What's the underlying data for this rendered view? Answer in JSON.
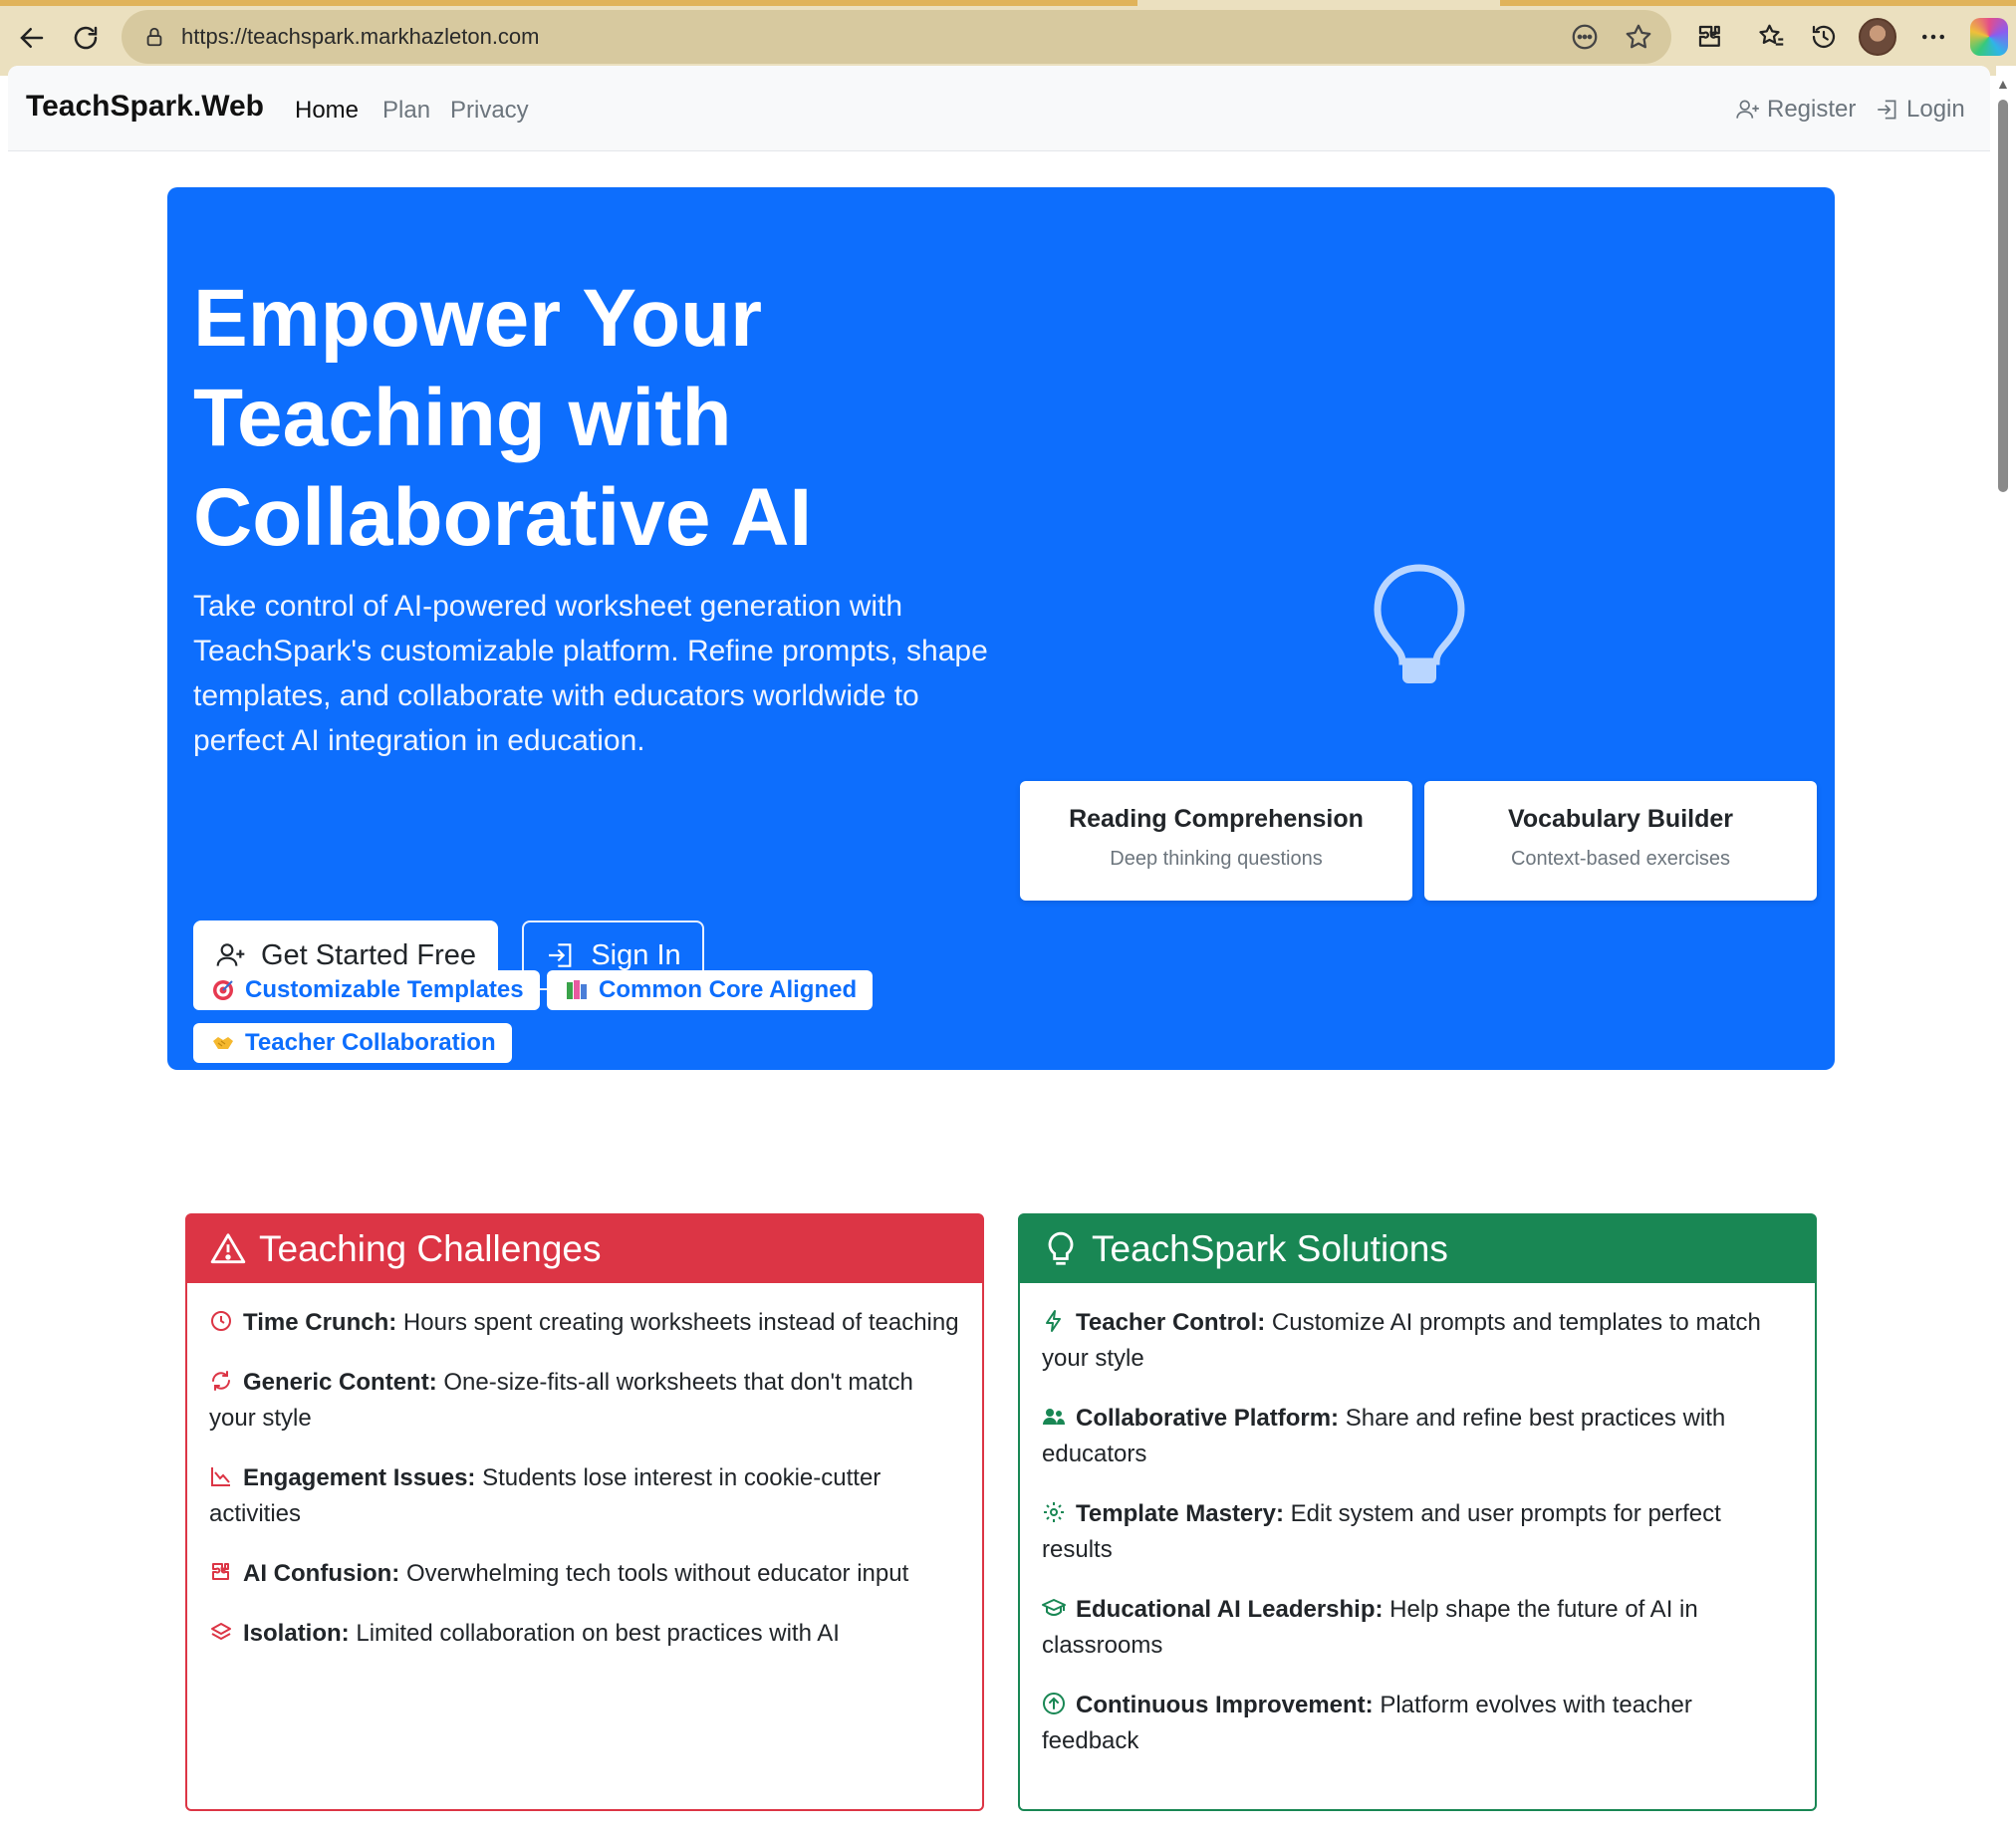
{
  "browser": {
    "url": "https://teachspark.markhazleton.com"
  },
  "navbar": {
    "brand": "TeachSpark.Web",
    "links": [
      {
        "label": "Home",
        "active": true
      },
      {
        "label": "Plan",
        "active": false
      },
      {
        "label": "Privacy",
        "active": false
      }
    ],
    "register_label": "Register",
    "login_label": "Login"
  },
  "hero": {
    "title": "Empower Your Teaching with Collaborative AI",
    "lead": "Take control of AI-powered worksheet generation with TeachSpark's customizable platform. Refine prompts, shape templates, and collaborate with educators worldwide to perfect AI integration in education.",
    "primary_button": "Get Started Free",
    "secondary_button": "Sign In",
    "badges": [
      {
        "icon": "target-emoji-icon",
        "label": "Customizable Templates"
      },
      {
        "icon": "books-emoji-icon",
        "label": "Common Core Aligned"
      },
      {
        "icon": "handshake-emoji-icon",
        "label": "Teacher Collaboration"
      }
    ],
    "feature_cards": [
      {
        "title": "Reading Comprehension",
        "subtitle": "Deep thinking questions"
      },
      {
        "title": "Vocabulary Builder",
        "subtitle": "Context-based exercises"
      }
    ],
    "colors": {
      "primary": "#0d6efd"
    }
  },
  "challenges": {
    "title": "Teaching Challenges",
    "color": "#dc3545",
    "items": [
      {
        "icon": "clock-icon",
        "label": "Time Crunch:",
        "text": " Hours spent creating worksheets instead of teaching"
      },
      {
        "icon": "arrows-repeat-icon",
        "label": "Generic Content:",
        "text": " One-size-fits-all worksheets that don't match your style"
      },
      {
        "icon": "graph-down-icon",
        "label": "Engagement Issues:",
        "text": " Students lose interest in cookie-cutter activities"
      },
      {
        "icon": "puzzle-icon",
        "label": "AI Confusion:",
        "text": " Overwhelming tech tools without educator input"
      },
      {
        "icon": "layers-icon",
        "label": "Isolation:",
        "text": " Limited collaboration on best practices with AI"
      }
    ]
  },
  "solutions": {
    "title": "TeachSpark Solutions",
    "color": "#198754",
    "items": [
      {
        "icon": "lightning-icon",
        "label": "Teacher Control:",
        "text": " Customize AI prompts and templates to match your style"
      },
      {
        "icon": "people-icon",
        "label": "Collaborative Platform:",
        "text": " Share and refine best practices with educators"
      },
      {
        "icon": "gear-icon",
        "label": "Template Mastery:",
        "text": " Edit system and user prompts for perfect results"
      },
      {
        "icon": "mortarboard-icon",
        "label": "Educational AI Leadership:",
        "text": " Help shape the future of AI in classrooms"
      },
      {
        "icon": "arrow-up-circle-icon",
        "label": "Continuous Improvement:",
        "text": " Platform evolves with teacher feedback"
      }
    ]
  }
}
